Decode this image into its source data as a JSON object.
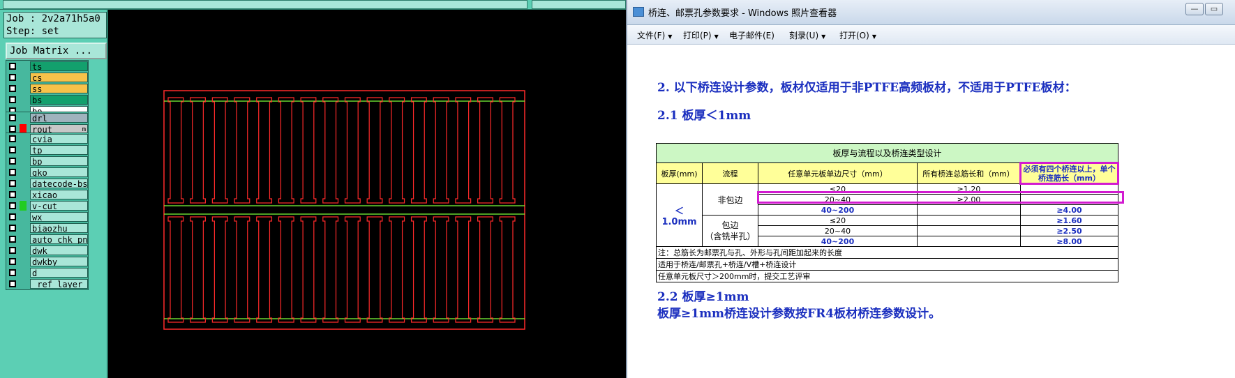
{
  "cam": {
    "job_line": "Job : 2v2a71h5a0",
    "step_line": "Step: set",
    "matrix_button": "Job Matrix ...",
    "layer_groups": [
      [
        {
          "name": "ts",
          "color": "#13a06d"
        },
        {
          "name": "cs",
          "color": "#f7c24a"
        },
        {
          "name": "ss",
          "color": "#f7c24a"
        },
        {
          "name": "bs",
          "color": "#13a06d"
        },
        {
          "name": "bo",
          "color": "#ffffff"
        }
      ],
      [
        {
          "name": "drl",
          "color": "#9fb3bd"
        },
        {
          "name": "rout",
          "color": "#c7c7c7",
          "swatch": "#ff0000",
          "suffix": "m"
        }
      ],
      [
        {
          "name": "cvia",
          "color": "#a9e6d8"
        },
        {
          "name": "tp",
          "color": "#a9e6d8"
        },
        {
          "name": "bp",
          "color": "#a9e6d8"
        },
        {
          "name": "gko",
          "color": "#a9e6d8"
        },
        {
          "name": "datecode-bs",
          "color": "#a9e6d8"
        },
        {
          "name": "xicao",
          "color": "#a9e6d8"
        },
        {
          "name": "v-cut",
          "color": "#a9e6d8",
          "swatch": "#22cc22"
        },
        {
          "name": "wx",
          "color": "#a9e6d8"
        },
        {
          "name": "biaozhu",
          "color": "#a9e6d8"
        },
        {
          "name": "auto_chk_pn",
          "color": "#a9e6d8"
        },
        {
          "name": "dwk",
          "color": "#a9e6d8"
        },
        {
          "name": "dwkby",
          "color": "#a9e6d8"
        },
        {
          "name": "d",
          "color": "#a9e6d8"
        },
        {
          "name": "_ref_layer",
          "color": "#a9e6d8"
        }
      ]
    ]
  },
  "viewer": {
    "title": "桥连、邮票孔参数要求 - Windows 照片查看器",
    "menu": [
      "文件(F)",
      "打印(P)",
      "电子邮件(E)",
      "刻录(U)",
      "打开(O)"
    ],
    "heading_2": "2.  以下桥连设计参数，板材仅适用于非PTFE高频板材，不适用于PTFE板材：",
    "heading_21": "2.1  板厚＜1mm",
    "table": {
      "caption": "板厚与流程以及桥连类型设计",
      "headers": [
        "板厚(mm)",
        "流程",
        "任意单元板单边尺寸（mm）",
        "所有桥连总筋长和（mm）",
        "必须有四个桥连以上，单个桥连筋长（mm）"
      ],
      "thickness": "＜1.0mm",
      "process_a": "非包边",
      "process_b": "包边",
      "process_b_note": "（含铣半孔）",
      "rows": [
        {
          "size": "≤20",
          "total": "≥1.20",
          "single": ""
        },
        {
          "size": "20~40",
          "total": "≥2.00",
          "single": ""
        },
        {
          "size": "40~200",
          "total": "",
          "single": "≥4.00"
        },
        {
          "size": "≤20",
          "total": "",
          "single": "≥1.60"
        },
        {
          "size": "20~40",
          "total": "",
          "single": "≥2.50"
        },
        {
          "size": "40~200",
          "total": "",
          "single": "≥8.00"
        }
      ],
      "notes": [
        "注：总筋长为邮票孔与孔、外形与孔间距加起来的长度",
        "适用于桥连/邮票孔+桥连/V槽+桥连设计",
        "任意单元板尺寸＞200mm时，提交工艺评审"
      ]
    },
    "heading_22": "2.2  板厚≥1mm",
    "para_22": "板厚≥1mm桥连设计参数按FR4板材桥连参数设计。"
  },
  "graphic": {
    "units_per_row": 16,
    "rows": 2,
    "outline_color": "#ff2a2a",
    "vcut_color": "#7cff3a"
  }
}
